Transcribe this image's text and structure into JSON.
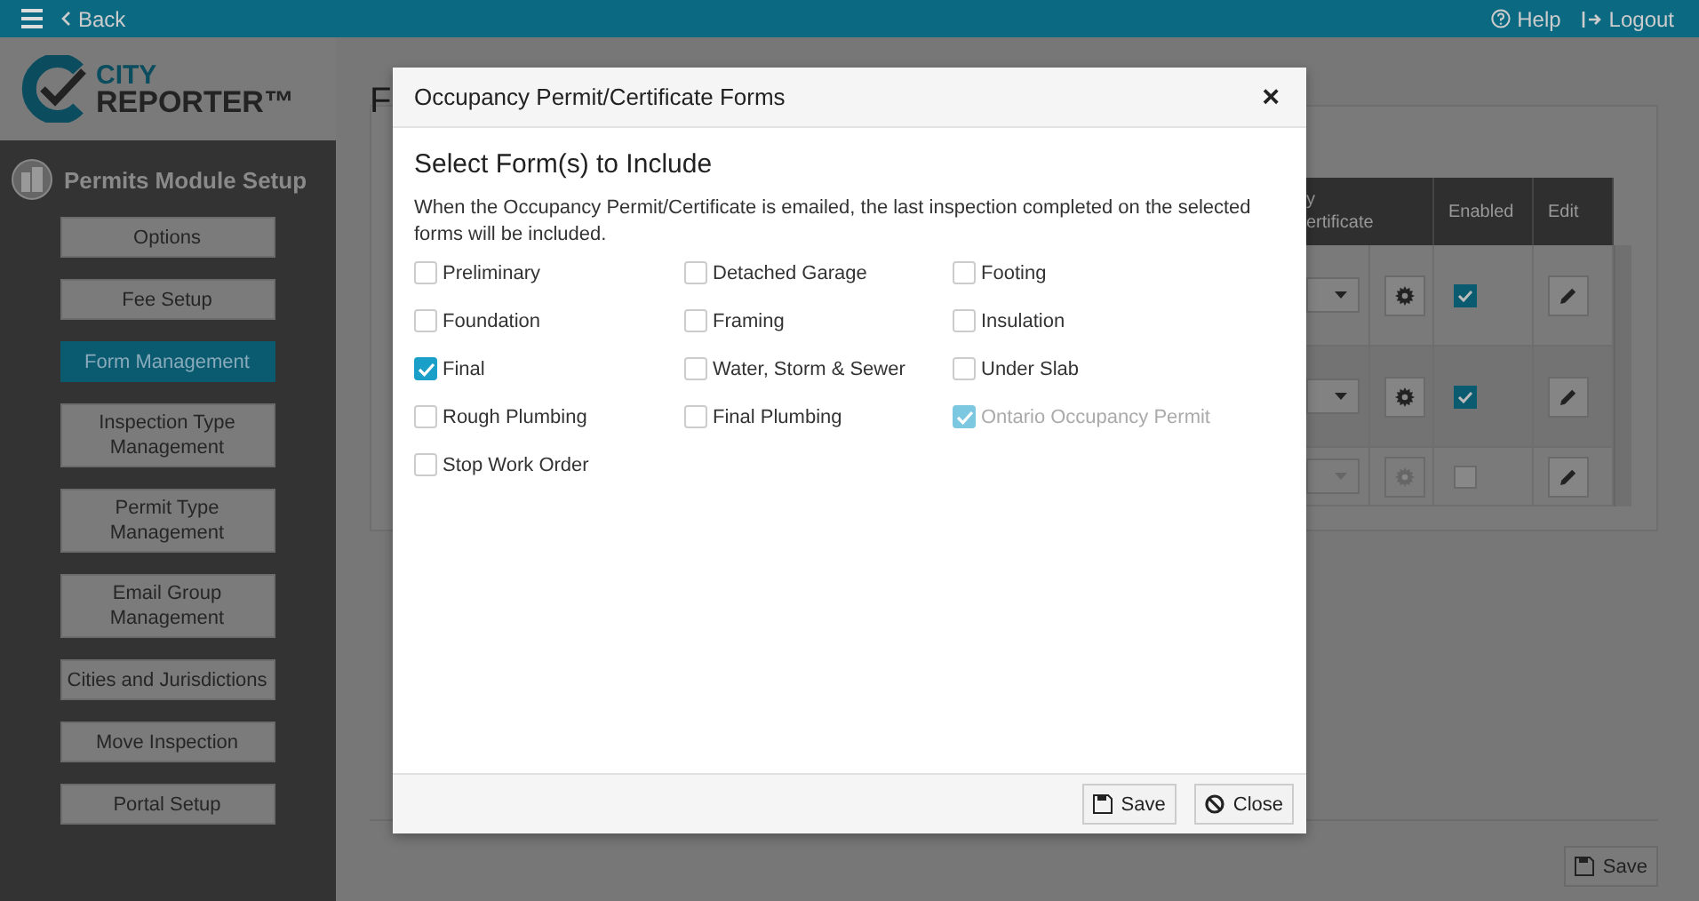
{
  "top_bar": {
    "back": "Back",
    "help": "Help",
    "logout": "Logout"
  },
  "logo": {
    "line1": "CITY",
    "line2": "REPORTER™"
  },
  "sidebar": {
    "title": "Permits Module Setup",
    "items": [
      {
        "label": "Options",
        "selected": false
      },
      {
        "label": "Fee Setup",
        "selected": false
      },
      {
        "label": "Form Management",
        "selected": true
      },
      {
        "label": "Inspection Type Management",
        "selected": false
      },
      {
        "label": "Permit Type Management",
        "selected": false
      },
      {
        "label": "Email Group Management",
        "selected": false
      },
      {
        "label": "Cities and Jurisdictions",
        "selected": false
      },
      {
        "label": "Move Inspection",
        "selected": false
      },
      {
        "label": "Portal Setup",
        "selected": false
      }
    ]
  },
  "page": {
    "heading": "F"
  },
  "table": {
    "columns": [
      {
        "lines": [
          "y",
          "ertificate"
        ]
      },
      {
        "lines": [
          "Enabled"
        ]
      },
      {
        "lines": [
          "Edit"
        ]
      }
    ],
    "rows": [
      {
        "enabled": true,
        "disabled": false
      },
      {
        "enabled": true,
        "disabled": false
      },
      {
        "enabled": false,
        "disabled": true
      }
    ]
  },
  "footer": {
    "save": "Save"
  },
  "modal": {
    "title": "Occupancy Permit/Certificate Forms",
    "close": "×",
    "heading": "Select Form(s) to Include",
    "description": "When the Occupancy Permit/Certificate is emailed, the last inspection completed on the selected forms will be included.",
    "forms": [
      {
        "label": "Preliminary",
        "checked": false,
        "disabled": false
      },
      {
        "label": "Detached Garage",
        "checked": false,
        "disabled": false
      },
      {
        "label": "Footing",
        "checked": false,
        "disabled": false
      },
      {
        "label": "Foundation",
        "checked": false,
        "disabled": false
      },
      {
        "label": "Framing",
        "checked": false,
        "disabled": false
      },
      {
        "label": "Insulation",
        "checked": false,
        "disabled": false
      },
      {
        "label": "Final",
        "checked": true,
        "disabled": false
      },
      {
        "label": "Water, Storm & Sewer",
        "checked": false,
        "disabled": false
      },
      {
        "label": "Under Slab",
        "checked": false,
        "disabled": false
      },
      {
        "label": "Rough Plumbing",
        "checked": false,
        "disabled": false
      },
      {
        "label": "Final Plumbing",
        "checked": false,
        "disabled": false
      },
      {
        "label": "Ontario Occupancy Permit",
        "checked": true,
        "disabled": true
      },
      {
        "label": "Stop Work Order",
        "checked": false,
        "disabled": false
      }
    ],
    "buttons": [
      {
        "label": "Save",
        "kind": "save"
      },
      {
        "label": "Close",
        "kind": "close"
      }
    ]
  }
}
